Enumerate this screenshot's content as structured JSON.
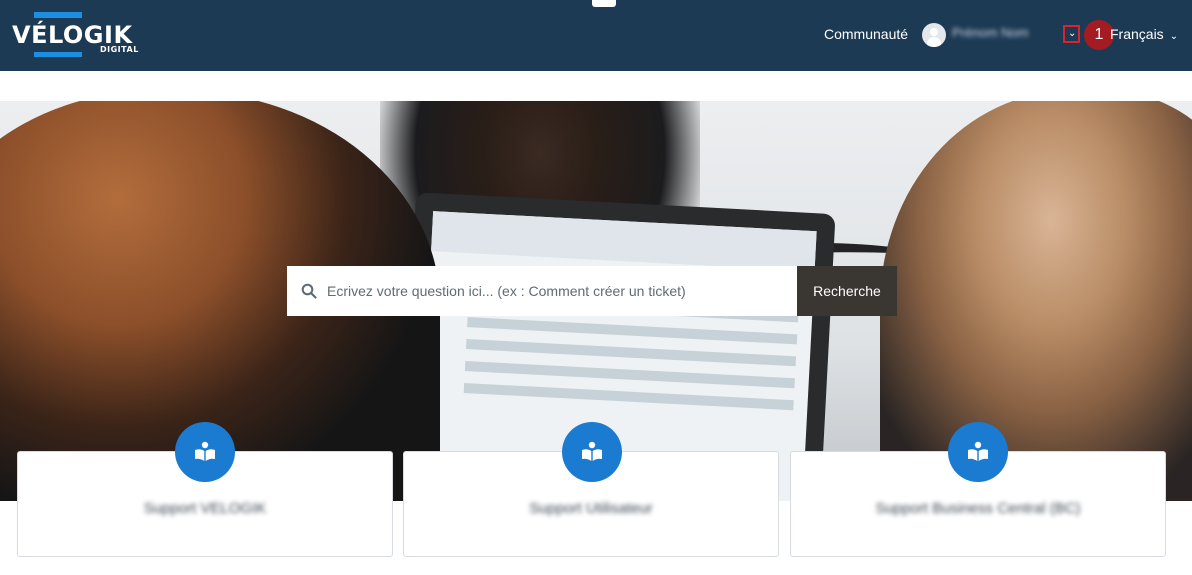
{
  "header": {
    "logo_text": "VÉLOGIK",
    "logo_subtext": "DIGITAL",
    "community_link": "Communauté",
    "user_name": "Prénom Nom",
    "marker_number": "1",
    "language": "Français"
  },
  "search": {
    "placeholder": "Ecrivez votre question ici... (ex : Comment créer un ticket)",
    "button_label": "Recherche"
  },
  "cards": [
    {
      "label": "Support VELOGIK"
    },
    {
      "label": "Support Utilisateur"
    },
    {
      "label": "Support Business Central (BC)"
    }
  ],
  "colors": {
    "nav_bg": "#1d3a54",
    "accent_blue": "#1a7bd1",
    "marker_red": "#a51b22",
    "search_button": "#3a3632"
  }
}
